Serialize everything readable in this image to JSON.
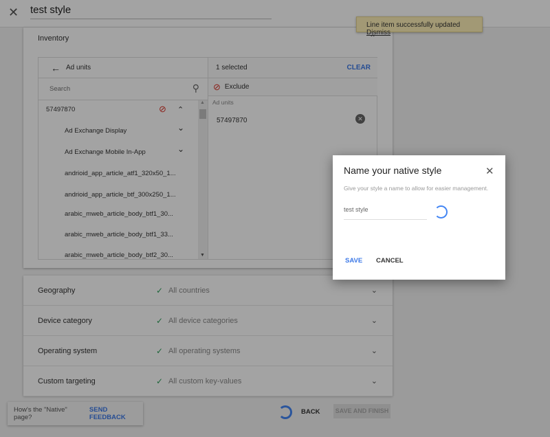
{
  "header": {
    "title_value": "test style"
  },
  "toast": {
    "message": "Line item successfully updated",
    "dismiss": "Dismiss",
    "color": "#fdf0b8"
  },
  "inventory": {
    "heading": "Inventory",
    "left": {
      "back_label": "Ad units",
      "search_placeholder": "Search",
      "items": [
        {
          "label": "57497870",
          "level": 0
        },
        {
          "label": "Ad Exchange Display",
          "level": 1
        },
        {
          "label": "Ad Exchange Mobile In-App",
          "level": 1
        },
        {
          "label": "andrioid_app_article_atf1_320x50_1...",
          "level": 1
        },
        {
          "label": "andrioid_app_article_btf_300x250_1...",
          "level": 1
        },
        {
          "label": "arabic_mweb_article_body_btf1_30...",
          "level": 1
        },
        {
          "label": "arabic_mweb_article_body_btf1_33...",
          "level": 1
        },
        {
          "label": "arabic_mweb_article_body_btf2_30...",
          "level": 1
        }
      ]
    },
    "right": {
      "selected_count": "1 selected",
      "clear": "CLEAR",
      "exclude": "Exclude",
      "section_label": "Ad units",
      "selected_item": "57497870"
    }
  },
  "targeting": [
    {
      "label": "Geography",
      "value": "All countries"
    },
    {
      "label": "Device category",
      "value": "All device categories"
    },
    {
      "label": "Operating system",
      "value": "All operating systems"
    },
    {
      "label": "Custom targeting",
      "value": "All custom key-values"
    }
  ],
  "feedback": {
    "question": "How's the \"Native\" page?",
    "link": "SEND FEEDBACK"
  },
  "footer": {
    "back": "BACK",
    "save_finish": "SAVE AND FINISH"
  },
  "dialog": {
    "title": "Name your native style",
    "description": "Give your style a name to allow for easier management.",
    "input_value": "test style",
    "save": "SAVE",
    "cancel": "CANCEL"
  },
  "colors": {
    "accent": "#3b78e7",
    "exclude": "#d93025",
    "check": "#2e9e5b"
  }
}
